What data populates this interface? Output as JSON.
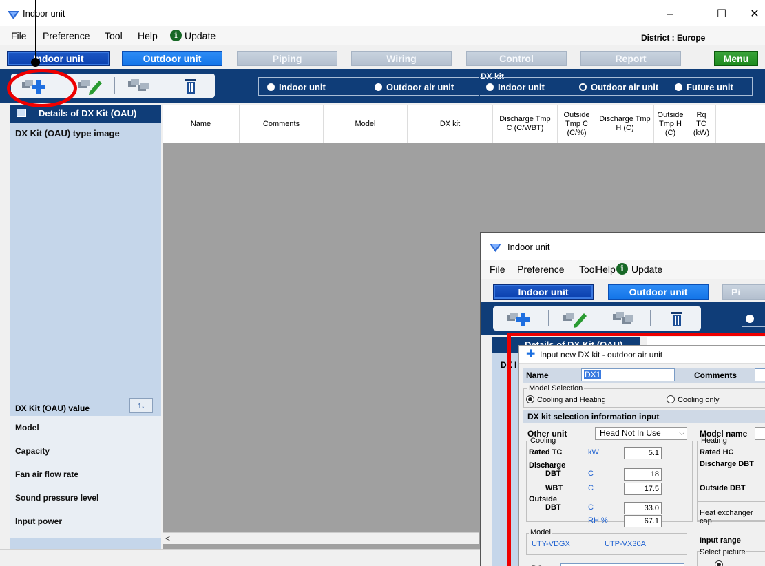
{
  "window": {
    "title": "Indoor unit",
    "controls": {
      "minimize": "–",
      "maximize": "☐",
      "close": "✕"
    }
  },
  "menu": {
    "items": [
      "File",
      "Preference",
      "Tool",
      "Help",
      "Update"
    ],
    "district": "District : Europe"
  },
  "nav": {
    "indoor": "Indoor unit",
    "outdoor": "Outdoor unit",
    "piping": "Piping",
    "wiring": "Wiring",
    "control": "Control",
    "report": "Report",
    "menu": "Menu"
  },
  "toolbar": {
    "radios_left": [
      "Indoor unit",
      "Outdoor air unit"
    ],
    "dx_kit_label": "DX kit",
    "radios_right": [
      "Indoor unit",
      "Outdoor air unit",
      "Future unit"
    ],
    "selected_right": "Outdoor air unit"
  },
  "left_panel": {
    "header": "Details of DX Kit (OAU)",
    "type_image": "DX Kit (OAU) type image",
    "value_header": "DX Kit (OAU) value",
    "values": [
      "Model",
      "Capacity",
      "Fan air flow rate",
      "Sound pressure level",
      "Input power"
    ]
  },
  "grid": {
    "columns": [
      {
        "label": "Name"
      },
      {
        "label": "Comments"
      },
      {
        "label": "Model"
      },
      {
        "label": "DX kit"
      },
      {
        "label": "Discharge Tmp C (C/WBT)"
      },
      {
        "label": "Outside Tmp C (C/%)"
      },
      {
        "label": "Discharge Tmp H (C)"
      },
      {
        "label": "Outside Tmp H (C)"
      },
      {
        "label": "Rq TC (kW)"
      }
    ]
  },
  "overlay": {
    "title": "Indoor unit",
    "menu": [
      "File",
      "Preference",
      "Tool",
      "Help",
      "Update"
    ],
    "nav": [
      "Indoor unit",
      "Outdoor unit",
      "Pi"
    ],
    "left_header": "Details of DX Kit (OAU)",
    "left_sub": "DX I"
  },
  "dialog": {
    "title": "Input new DX kit - outdoor air unit",
    "name_label": "Name",
    "name_value": "DX1",
    "comments_label": "Comments",
    "model_selection_label": "Model Selection",
    "cooling_and_heating": "Cooling and Heating",
    "cooling_only": "Cooling only",
    "section_title": "DX kit selection information input",
    "other_unit_label": "Other unit",
    "other_unit_value": "Head Not In Use",
    "model_name_label": "Model name",
    "cooling_group": "Cooling",
    "heating_group": "Heating",
    "rated_tc": "Rated TC",
    "rated_tc_unit": "kW",
    "rated_tc_value": "5.1",
    "discharge": "Discharge",
    "dbt": "DBT",
    "dbt_unit": "C",
    "dbt_value": "18",
    "wbt": "WBT",
    "wbt_unit": "C",
    "wbt_value": "17.5",
    "outside": "Outside",
    "outside_dbt": "DBT",
    "outside_dbt_unit": "C",
    "outside_dbt_value": "33.0",
    "rh_unit": "RH %",
    "rh_value": "67.1",
    "rated_hc": "Rated HC",
    "discharge_dbt": "Discharge  DBT",
    "outside_dbt_h": "Outside DBT",
    "heat_exchanger": "Heat exchanger cap",
    "input_range": "Input range",
    "select_picture": "Select picture",
    "model_group": "Model",
    "model_left": "UTY-VDGX",
    "model_right": "UTP-VX30A",
    "bottom_label": "DC"
  }
}
